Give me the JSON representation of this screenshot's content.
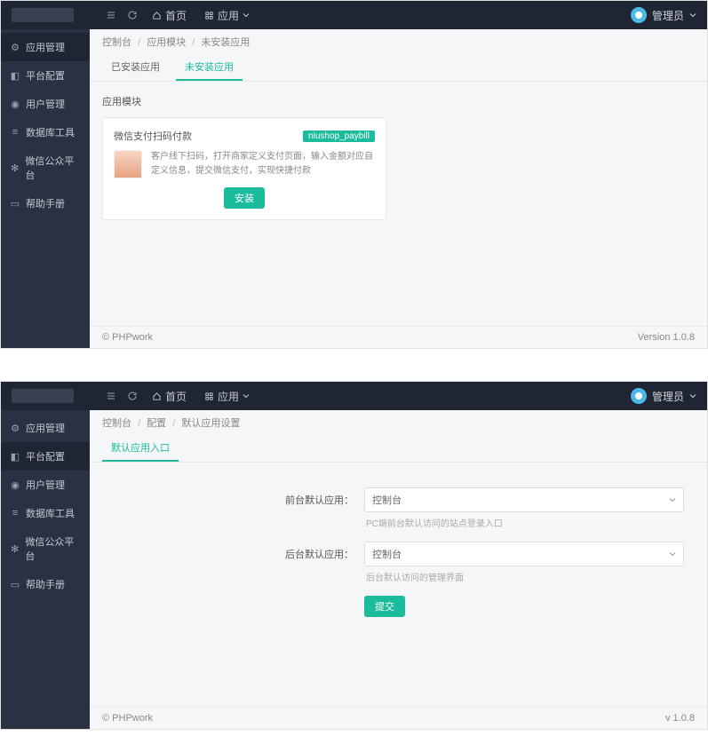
{
  "topbar": {
    "home": "首页",
    "apps": "应用",
    "user": "管理员"
  },
  "sidebar": {
    "items": [
      {
        "icon": "gear",
        "label": "应用管理"
      },
      {
        "icon": "layers",
        "label": "平台配置"
      },
      {
        "icon": "user",
        "label": "用户管理"
      },
      {
        "icon": "db",
        "label": "数据库工具"
      },
      {
        "icon": "wechat",
        "label": "微信公众平台"
      },
      {
        "icon": "book",
        "label": "帮助手册"
      }
    ]
  },
  "panel1": {
    "breadcrumb": [
      "控制台",
      "应用模块",
      "未安装应用"
    ],
    "tabs": [
      "已安装应用",
      "未安装应用"
    ],
    "activeTab": 1,
    "sectionTitle": "应用模块",
    "card": {
      "title": "微信支付扫码付款",
      "badge": "niushop_paybill",
      "desc": "客户线下扫码，打开商家定义支付页面，输入金额对应自定义信息，提交微信支付，实现快捷付款",
      "action": "安装"
    }
  },
  "panel2": {
    "sidebar_active": 1,
    "sidebar_label_alt": "平台配置",
    "breadcrumb": [
      "控制台",
      "配置",
      "默认应用设置"
    ],
    "tabs": [
      "默认应用入口"
    ],
    "activeTab": 0,
    "form": {
      "frontLabel": "前台默认应用：",
      "frontValue": "控制台",
      "frontHelp": "PC端前台默认访问的站点登录入口",
      "backLabel": "后台默认应用：",
      "backValue": "控制台",
      "backHelp": "后台默认访问的管理界面",
      "submit": "提交"
    }
  },
  "footer": {
    "copyright": "© PHPwork",
    "version": "Version 1.0.8",
    "version_short": "v 1.0.8"
  }
}
